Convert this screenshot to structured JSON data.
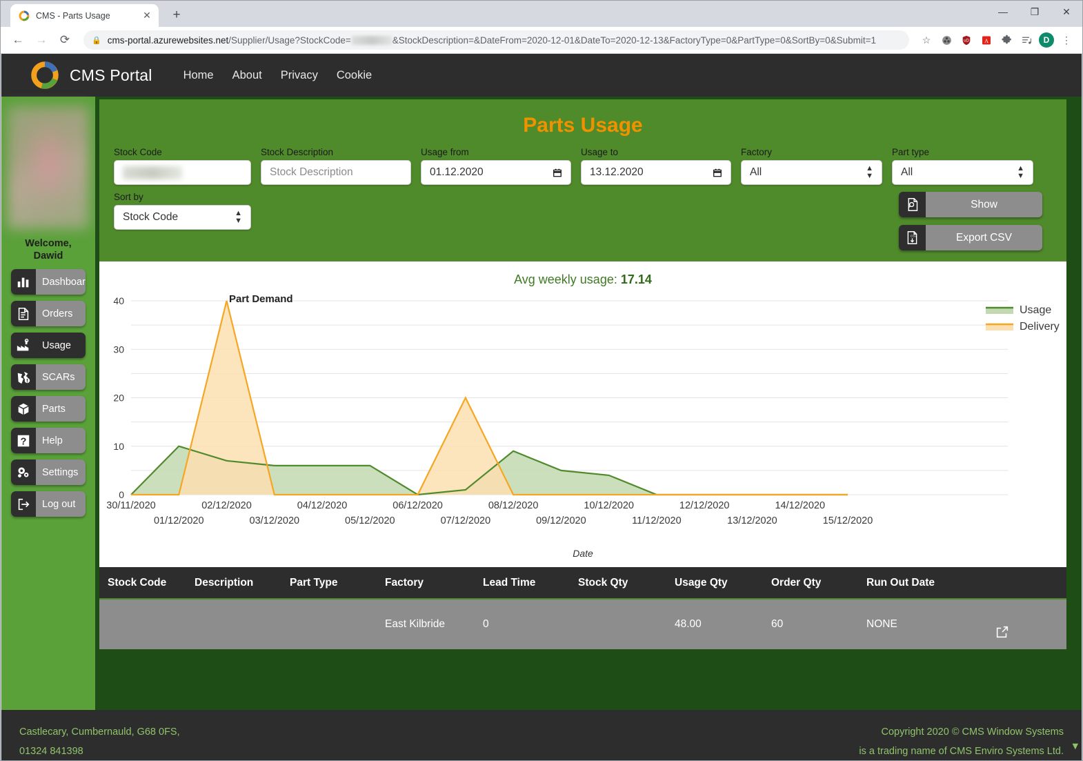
{
  "browser": {
    "tab_title": "CMS - Parts Usage",
    "tab_close": "✕",
    "new_tab": "+",
    "back": "←",
    "forward": "→",
    "reload": "⟳",
    "url_host": "cms-portal.azurewebsites.net",
    "url_path_a": "/Supplier/Usage?StockCode=",
    "url_path_b": "&StockDescription=&DateFrom=2020-12-01&DateTo=2020-12-13&FactoryType=0&PartType=0&SortBy=0&Submit=1",
    "star": "☆",
    "avatar_initial": "D",
    "menu": "⋮",
    "minimize": "—",
    "maximize": "❐",
    "close": "✕"
  },
  "navbar": {
    "brand": "CMS Portal",
    "links": [
      "Home",
      "About",
      "Privacy",
      "Cookie"
    ]
  },
  "sidebar": {
    "welcome_line1": "Welcome,",
    "welcome_line2": "Dawid",
    "items": [
      {
        "label": "Dashboard",
        "icon": "bar-chart-icon",
        "active": false
      },
      {
        "label": "Orders",
        "icon": "document-arrow-icon",
        "active": false
      },
      {
        "label": "Usage",
        "icon": "factory-icon",
        "active": true
      },
      {
        "label": "SCARs",
        "icon": "broken-box-alert-icon",
        "active": false
      },
      {
        "label": "Parts",
        "icon": "box-icon",
        "active": false
      },
      {
        "label": "Help",
        "icon": "question-mark-icon",
        "active": false
      },
      {
        "label": "Settings",
        "icon": "gears-icon",
        "active": false
      },
      {
        "label": "Log out",
        "icon": "logout-arrow-icon",
        "active": false
      }
    ]
  },
  "page": {
    "title": "Parts Usage",
    "accent_orange": "#f29100",
    "accent_green": "#4f8a2b"
  },
  "filters": {
    "stock_code": {
      "label": "Stock Code",
      "value": "",
      "redacted": true
    },
    "stock_description": {
      "label": "Stock Description",
      "value": "",
      "placeholder": "Stock Description"
    },
    "usage_from": {
      "label": "Usage from",
      "value": "01.12.2020"
    },
    "usage_to": {
      "label": "Usage to",
      "value": "13.12.2020"
    },
    "factory": {
      "label": "Factory",
      "value": "All"
    },
    "part_type": {
      "label": "Part type",
      "value": "All"
    },
    "sort_by": {
      "label": "Sort by",
      "value": "Stock Code"
    },
    "show_button": "Show",
    "export_button": "Export CSV"
  },
  "summary": {
    "avg_label": "Avg weekly usage:",
    "avg_value": "17.14"
  },
  "chart_data": {
    "type": "area",
    "title": "Part Demand",
    "xlabel": "Date",
    "ylabel": "",
    "ylim": [
      0,
      40
    ],
    "yticks": [
      0,
      10,
      20,
      30,
      40
    ],
    "grid": true,
    "legend_position": "right",
    "categories": [
      "30/11/2020",
      "01/12/2020",
      "02/12/2020",
      "03/12/2020",
      "04/12/2020",
      "05/12/2020",
      "06/12/2020",
      "07/12/2020",
      "08/12/2020",
      "09/12/2020",
      "10/12/2020",
      "11/12/2020",
      "12/12/2020",
      "13/12/2020",
      "14/12/2020",
      "15/12/2020"
    ],
    "series": [
      {
        "name": "Usage",
        "color": "#4f8a2b",
        "fill": "#c3d9b2",
        "values": [
          0,
          10,
          7,
          6,
          6,
          6,
          0,
          1,
          9,
          5,
          4,
          0,
          0,
          0,
          0,
          0
        ]
      },
      {
        "name": "Delivery",
        "color": "#f5a623",
        "fill": "#fbdfb0",
        "values": [
          0,
          0,
          40,
          0,
          0,
          0,
          0,
          20,
          0,
          0,
          0,
          0,
          0,
          0,
          0,
          0
        ]
      }
    ]
  },
  "table": {
    "headers": [
      "Stock Code",
      "Description",
      "Part Type",
      "Factory",
      "Lead Time",
      "Stock Qty",
      "Usage Qty",
      "Order Qty",
      "Run Out Date"
    ],
    "rows": [
      {
        "stock_code": "",
        "stock_code_redacted": true,
        "description": "",
        "description_redacted": true,
        "part_type": "",
        "factory": "East Kilbride",
        "lead_time": "0",
        "stock_qty": "",
        "stock_qty_redacted": true,
        "usage_qty": "48.00",
        "order_qty": "60",
        "run_out_date": "NONE"
      }
    ]
  },
  "footer": {
    "address": "Castlecary, Cumbernauld, G68 0FS,",
    "phone": "01324 841398",
    "copyright": "Copyright 2020 © CMS Window Systems",
    "trading": "is a trading name of CMS Enviro Systems Ltd."
  }
}
